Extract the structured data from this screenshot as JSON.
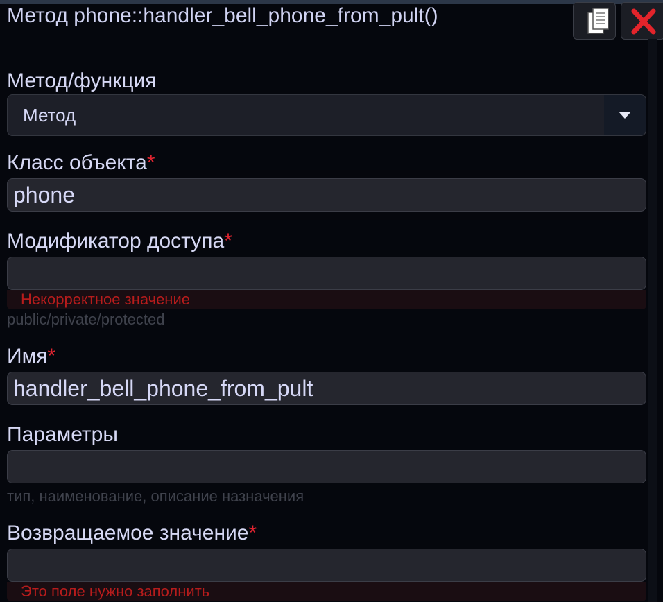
{
  "window": {
    "title": "Метод phone::handler_bell_phone_from_pult()",
    "copy_button": "copy-icon",
    "close_button": "close-icon"
  },
  "form": {
    "kind": {
      "label": "Метод/функция",
      "value": "Метод"
    },
    "class_name": {
      "label": "Класс объекта",
      "required_mark": "*",
      "value": "phone"
    },
    "access_modifier": {
      "label": "Модификатор доступа",
      "required_mark": "*",
      "value": "",
      "error": "Некорректное значение",
      "hint": "public/private/protected"
    },
    "name": {
      "label": "Имя",
      "required_mark": "*",
      "value": "handler_bell_phone_from_pult"
    },
    "parameters": {
      "label": "Параметры",
      "value": "",
      "hint": "тип, наименование, описание назначения"
    },
    "return_value": {
      "label": "Возвращаемое значение",
      "required_mark": "*",
      "value": "",
      "error": "Это поле нужно заполнить"
    }
  },
  "colors": {
    "background": "#05070d",
    "field": "#25262e",
    "text": "#d6d8f4",
    "required": "#e02430",
    "error": "#b71c1c",
    "close_icon": "#e3242b"
  }
}
